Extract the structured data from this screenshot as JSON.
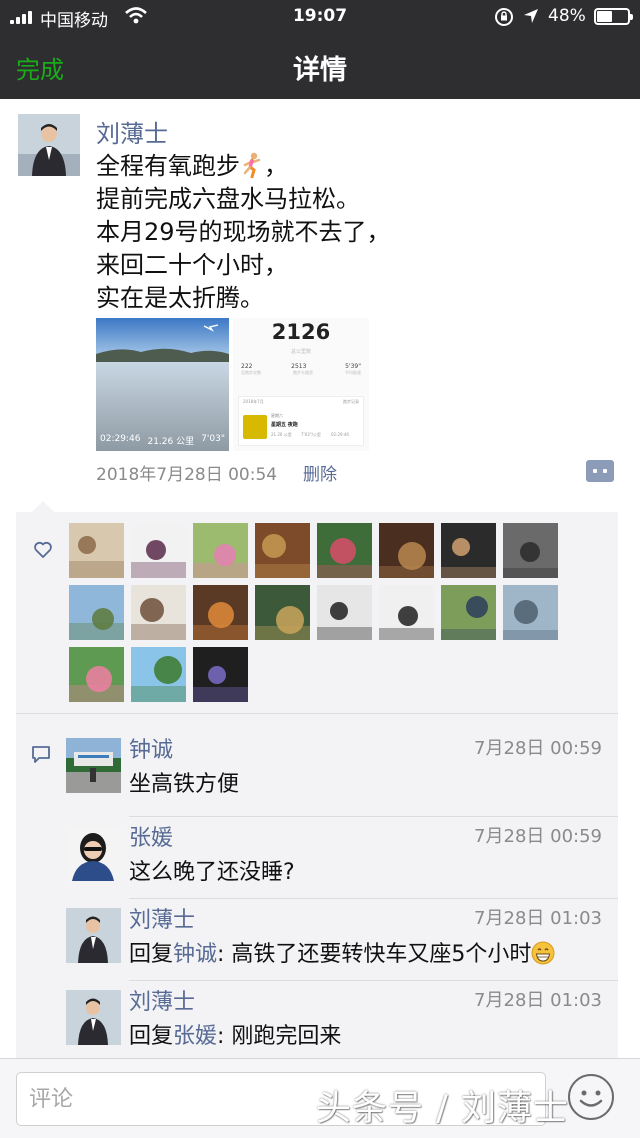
{
  "status_bar": {
    "carrier": "中国移动",
    "time": "19:07",
    "battery": "48%",
    "battery_level": 0.48,
    "icons": [
      "signal-icon",
      "wifi-icon",
      "rotation-lock-icon",
      "location-icon",
      "battery-icon"
    ]
  },
  "nav": {
    "left_button": "完成",
    "title": "详情"
  },
  "post": {
    "author": "刘薄士",
    "lines": [
      "全程有氧跑步",
      "提前完成六盘水马拉松。",
      "本月29号的现场就不去了，",
      "来回二十个小时，",
      "实在是太折腾。"
    ],
    "line1_suffix": "，",
    "runner_emoji_icon": "runner-icon",
    "photo1": {
      "duration": "02:29:46",
      "distance": "21.26 公里",
      "pace": "7'03\""
    },
    "photo2": {
      "big_number": "2126",
      "sub": "总公里数",
      "stats": [
        "222",
        "2513",
        "5'39\""
      ],
      "stat_labels": [
        "总跑步次数",
        "跑步卡路里",
        "平均配速"
      ],
      "card_header": "2018年7月",
      "card_header_right": "跑步记录",
      "card_line1": "星期六",
      "card_line2": "星期五 夜跑",
      "card_stat1": "21.26 公里",
      "card_stat2": "7'03\"/公里",
      "card_stat3": "02:29:46"
    },
    "timestamp": "2018年7月28日 00:54",
    "delete_label": "删除"
  },
  "likes": {
    "count": 19,
    "icon": "heart-outline-icon"
  },
  "comments": [
    {
      "name": "钟诚",
      "time": "7月28日 00:59",
      "text": "坐高铁方便",
      "reply_to": "",
      "text_after": ""
    },
    {
      "name": "张媛",
      "time": "7月28日 00:59",
      "text": "这么晚了还没睡?",
      "reply_to": "",
      "text_after": ""
    },
    {
      "name": "刘薄士",
      "time": "7月28日 01:03",
      "text": "回复",
      "reply_to": "钟诚",
      "text_after": ": 高铁了还要转快车又座5个小时"
    },
    {
      "name": "刘薄士",
      "time": "7月28日 01:03",
      "text": "回复",
      "reply_to": "张媛",
      "text_after": ": 刚跑完回来"
    }
  ],
  "input": {
    "placeholder": "评论"
  },
  "watermark": "头条号 / 刘薄士",
  "colors": {
    "accent_green": "#1aad19",
    "link_blue": "#576b95",
    "topbar": "#2e2e31"
  }
}
